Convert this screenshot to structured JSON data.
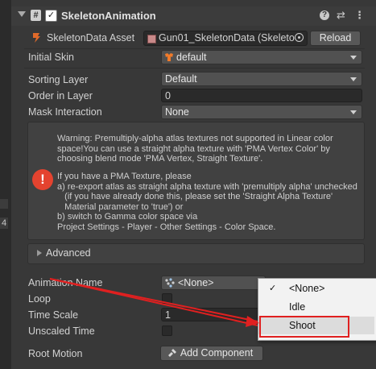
{
  "header": {
    "script_icon": "#",
    "check_mark": "✓",
    "component_title": "SkeletonAnimation",
    "help_icon": "?",
    "settings_icon": "⇄",
    "more_icon": "⋮"
  },
  "left_strip": {
    "number": "4"
  },
  "skeleton_data": {
    "label": "SkeletonData Asset",
    "value": "Gun01_SkeletonData (Skeleto",
    "reload_label": "Reload"
  },
  "initial_skin": {
    "label": "Initial Skin",
    "value": "default"
  },
  "sorting_layer": {
    "label": "Sorting Layer",
    "value": "Default"
  },
  "order_in_layer": {
    "label": "Order in Layer",
    "value": "0"
  },
  "mask_interaction": {
    "label": "Mask Interaction",
    "value": "None"
  },
  "warning": {
    "line1": "Warning: Premultiply-alpha atlas textures not supported in Linear color\nspace!You can use a straight alpha texture with 'PMA Vertex Color' by\nchoosing blend mode 'PMA Vertex, Straight Texture'.",
    "line2": "If you have a PMA Texture, please\na) re-export atlas as straight alpha texture with 'premultiply alpha' unchecked\n   (if you have already done this, please set the 'Straight Alpha Texture'\n   Material parameter to 'true') or\nb) switch to Gamma color space via\nProject Settings - Player - Other Settings - Color Space.",
    "icon": "!"
  },
  "advanced": {
    "label": "Advanced"
  },
  "animation_name": {
    "label": "Animation Name",
    "value": "<None>"
  },
  "loop": {
    "label": "Loop"
  },
  "time_scale": {
    "label": "Time Scale",
    "value": "1"
  },
  "unscaled_time": {
    "label": "Unscaled Time"
  },
  "root_motion": {
    "label": "Root Motion",
    "button": "Add Component"
  },
  "dropdown_menu": {
    "items": [
      {
        "label": "<None>",
        "checked": "✓"
      },
      {
        "label": "Idle",
        "checked": ""
      },
      {
        "label": "Shoot",
        "checked": ""
      }
    ]
  },
  "annotation_color": "#e02020"
}
